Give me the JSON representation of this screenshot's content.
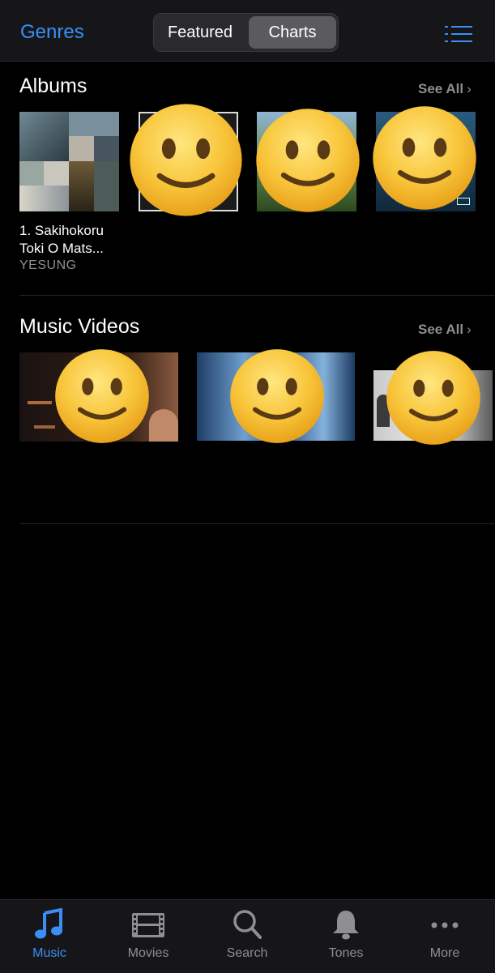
{
  "nav": {
    "genres_label": "Genres",
    "segments": [
      "Featured",
      "Charts"
    ],
    "selected_segment": "Charts",
    "menu_icon": "list-icon"
  },
  "albums": {
    "title": "Albums",
    "see_all": "See All",
    "items": [
      {
        "title": "1. Sakihokoru Toki O Mats...",
        "artist": "YESUNG"
      }
    ]
  },
  "music_videos": {
    "title": "Music Videos",
    "see_all": "See All"
  },
  "tabbar": {
    "items": [
      {
        "label": "Music",
        "icon": "music-note-icon",
        "active": true
      },
      {
        "label": "Movies",
        "icon": "film-icon",
        "active": false
      },
      {
        "label": "Search",
        "icon": "search-icon",
        "active": false
      },
      {
        "label": "Tones",
        "icon": "bell-icon",
        "active": false
      },
      {
        "label": "More",
        "icon": "more-dots-icon",
        "active": false
      }
    ]
  },
  "colors": {
    "accent": "#3a8ff7",
    "background": "#000000",
    "bar": "#161618",
    "secondary_text": "#8e8e93"
  }
}
